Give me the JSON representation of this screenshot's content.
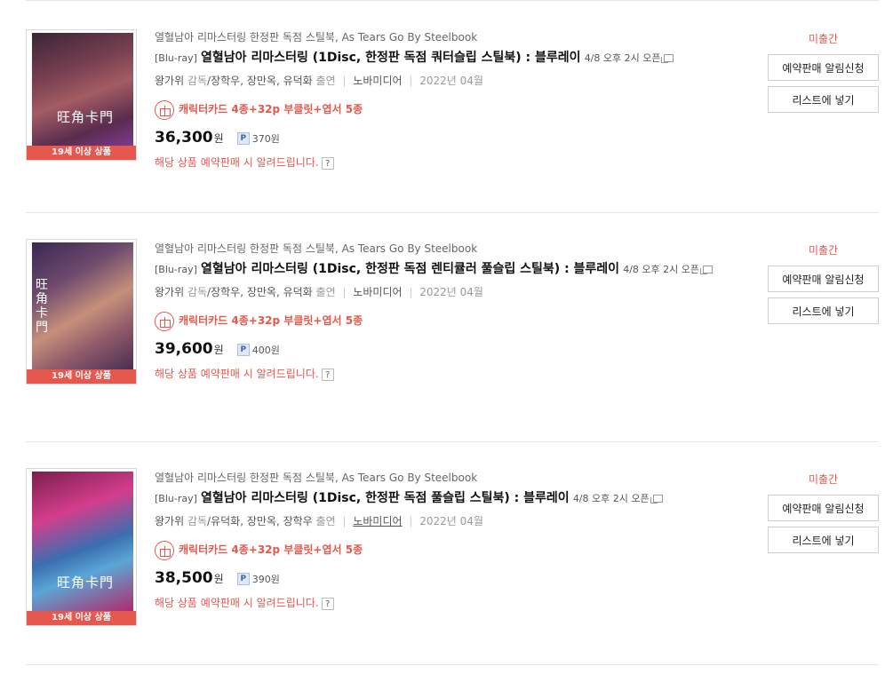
{
  "items": [
    {
      "series": "열혈남아 리마스터링 한정판 독점 스틸북, As Tears Go By Steelbook",
      "format": "[Blu-ray]",
      "title": "열혈남아 리마스터링 (1Disc, 한정판 독점 쿼터슬립 스틸북) : 블루레이",
      "release": "4/8 오후 2시 오픈",
      "director": "왕가위",
      "director_role": "감독",
      "cast": "/장학우, 장만옥, 유덕화",
      "cast_role": "출연",
      "publisher": "노바미디어",
      "date": "2022년 04월",
      "gift": "캐릭터카드 4종+32p 부클릿+엽서 5종",
      "price": "36,300",
      "won": "원",
      "points": "370원",
      "notice": "해당 상품 예약판매 시 알려드립니다.",
      "adult_label": "19세 이상 상품",
      "status": "미출간",
      "btn_notify": "예약판매 알림신청",
      "btn_list": "리스트에 넣기",
      "cover_title": "旺角卡門"
    },
    {
      "series": "열혈남아 리마스터링 한정판 독점 스틸북, As Tears Go By Steelbook",
      "format": "[Blu-ray]",
      "title": "열혈남아 리마스터링 (1Disc, 한정판 독점 렌티큘러 풀슬립 스틸북) : 블루레이",
      "release": "4/8 오후 2시 오픈",
      "director": "왕가위",
      "director_role": "감독",
      "cast": "/장학우, 장만옥, 유덕화",
      "cast_role": "출연",
      "publisher": "노바미디어",
      "date": "2022년 04월",
      "gift": "캐릭터카드 4종+32p 부클릿+엽서 5종",
      "price": "39,600",
      "won": "원",
      "points": "400원",
      "notice": "해당 상품 예약판매 시 알려드립니다.",
      "adult_label": "19세 이상 상품",
      "status": "미출간",
      "btn_notify": "예약판매 알림신청",
      "btn_list": "리스트에 넣기",
      "cover_title": "旺角卡門"
    },
    {
      "series": "열혈남아 리마스터링 한정판 독점 스틸북, As Tears Go By Steelbook",
      "format": "[Blu-ray]",
      "title": "열혈남아 리마스터링 (1Disc, 한정판 독점 풀슬립 스틸북) : 블루레이",
      "release": "4/8 오후 2시 오픈",
      "director": "왕가위",
      "director_role": "감독",
      "cast": "/유덕화, 장만옥, 장학우",
      "cast_role": "출연",
      "publisher": "노바미디어",
      "date": "2022년 04월",
      "gift": "캐릭터카드 4종+32p 부클릿+엽서 5종",
      "price": "38,500",
      "won": "원",
      "points": "390원",
      "notice": "해당 상품 예약판매 시 알려드립니다.",
      "adult_label": "19세 이상 상품",
      "status": "미출간",
      "btn_notify": "예약판매 알림신청",
      "btn_list": "리스트에 넣기",
      "cover_title": "旺角卡門"
    }
  ],
  "colors": {
    "accent": "#e4584e",
    "divider": "#e6e6e6"
  },
  "icons": {
    "gift": "gift-icon",
    "popup": "new-window-icon",
    "help": "question-icon",
    "points": "point-badge-icon"
  }
}
